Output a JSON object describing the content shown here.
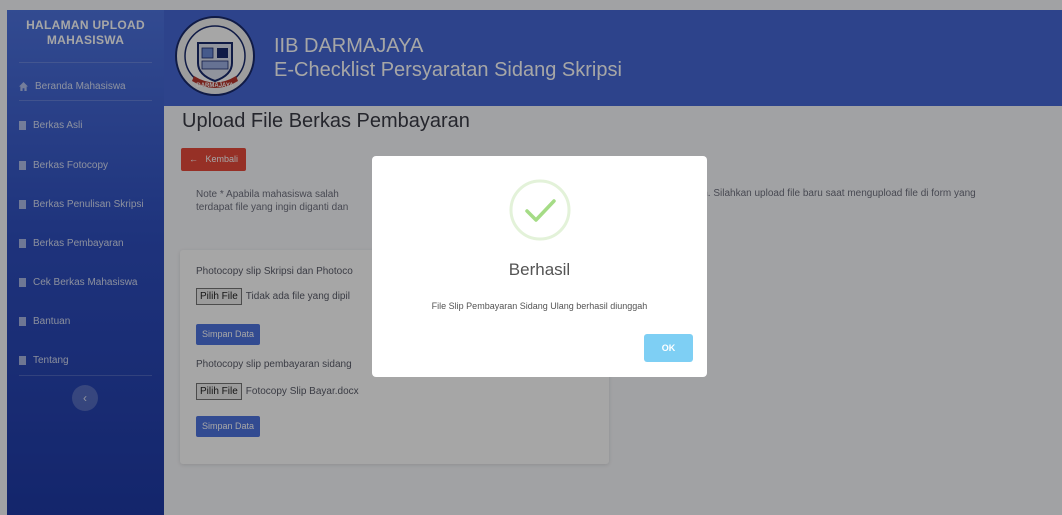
{
  "sidebar": {
    "brand_line1": "HALAMAN UPLOAD",
    "brand_line2": "MAHASISWA",
    "items": [
      {
        "label": "Beranda Mahasiswa",
        "icon": "home-icon"
      },
      {
        "label": "Berkas Asli",
        "icon": "file-icon"
      },
      {
        "label": "Berkas Fotocopy",
        "icon": "file-icon"
      },
      {
        "label": "Berkas Penulisan Skripsi",
        "icon": "file-icon"
      },
      {
        "label": "Berkas Pembayaran",
        "icon": "file-icon"
      },
      {
        "label": "Cek Berkas Mahasiswa",
        "icon": "file-icon"
      },
      {
        "label": "Bantuan",
        "icon": "file-icon"
      },
      {
        "label": "Tentang",
        "icon": "file-icon"
      }
    ],
    "toggle_glyph": "‹"
  },
  "header": {
    "title_line1": "IIB DARMAJAYA",
    "title_line2": "E-Checklist Persyaratan Sidang Skripsi",
    "logo_text_bottom": "DARMAJAYA"
  },
  "main": {
    "page_title": "Upload File Berkas Pembayaran",
    "back_label": "Kembali",
    "note_left_line1": "Note * Apabila mahasiswa salah",
    "note_left_line2": "terdapat file yang ingin diganti dan",
    "note_right": "in. Silahkan upload file baru saat mengupload file di form yang",
    "field1_label": "Photocopy slip Skripsi dan Photoco",
    "field1_button": "Pilih File",
    "field1_value": "Tidak ada file yang dipil",
    "save1_label": "Simpan Data",
    "field2_label": "Photocopy slip pembayaran sidang",
    "field2_button": "Pilih File",
    "field2_value": "Fotocopy Slip Bayar.docx",
    "save2_label": "Simpan Data"
  },
  "modal": {
    "title": "Berhasil",
    "message": "File Slip Pembayaran Sidang Ulang berhasil diunggah",
    "ok_label": "OK",
    "icon": "success-check-icon"
  },
  "colors": {
    "sidebar": "#4e73df",
    "header": "#4568d6",
    "danger": "#e74a3b",
    "primary": "#4e73df",
    "ok_button": "#7ecff4",
    "success_green": "#a5dc86"
  }
}
